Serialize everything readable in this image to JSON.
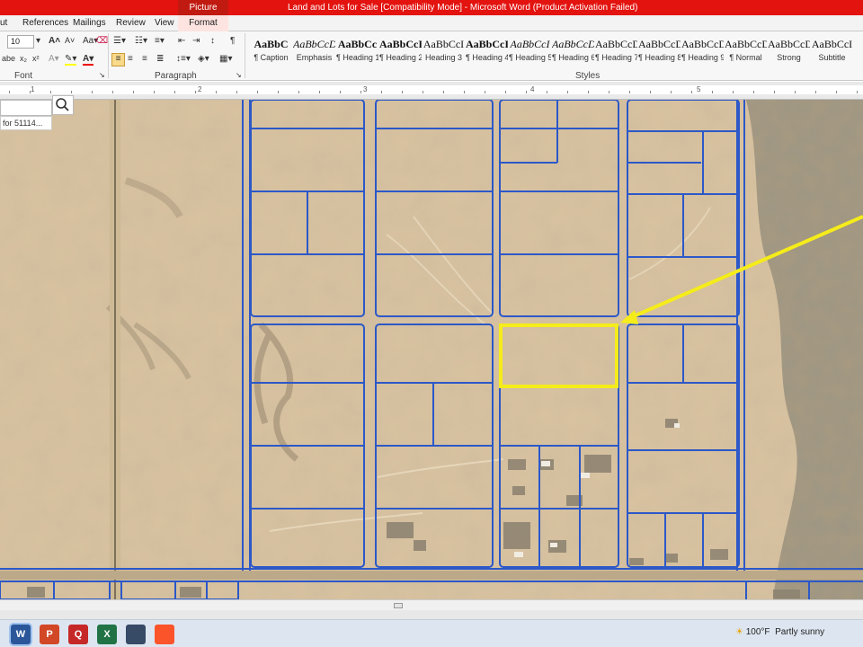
{
  "titlebar": {
    "title": "Land and Lots for Sale [Compatibility Mode] - Microsoft Word (Product Activation Failed)",
    "context_tab": "Picture Tools"
  },
  "tabs": [
    "ut",
    "References",
    "Mailings",
    "Review",
    "View"
  ],
  "context_format_tab": "Format",
  "ribbon": {
    "font_size": "10",
    "font_group": "Font",
    "paragraph_group": "Paragraph",
    "styles_group": "Styles",
    "styles": [
      {
        "preview": "AaBbC",
        "name": "¶ Caption"
      },
      {
        "preview": "AaBbCcDc",
        "name": "Emphasis"
      },
      {
        "preview": "AaBbCc",
        "name": "¶ Heading 1"
      },
      {
        "preview": "AaBbCcI",
        "name": "¶ Heading 2"
      },
      {
        "preview": "AaBbCcI",
        "name": "Heading 3"
      },
      {
        "preview": "AaBbCcI",
        "name": "¶ Heading 4"
      },
      {
        "preview": "AaBbCcI",
        "name": "¶ Heading 5"
      },
      {
        "preview": "AaBbCcDc",
        "name": "¶ Heading 6"
      },
      {
        "preview": "AaBbCcDc",
        "name": "¶ Heading 7"
      },
      {
        "preview": "AaBbCcDc",
        "name": "¶ Heading 8"
      },
      {
        "preview": "AaBbCcDc",
        "name": "¶ Heading 9"
      },
      {
        "preview": "AaBbCcDc",
        "name": "¶ Normal"
      },
      {
        "preview": "AaBbCcDd",
        "name": "Strong"
      },
      {
        "preview": "AaBbCcI",
        "name": "Subtitle"
      }
    ]
  },
  "ruler": {
    "numbers": [
      "1",
      "2",
      "3",
      "4",
      "5"
    ]
  },
  "map": {
    "search_result": "for 51114...",
    "parcel_line_color": "#2c58c8",
    "highlight_color": "#f5ec1a"
  },
  "taskbar": {
    "apps": [
      {
        "label": "W",
        "icon": "word-icon",
        "color": "#2b579a"
      },
      {
        "label": "P",
        "icon": "powerpoint-icon",
        "color": "#d24726"
      },
      {
        "label": "Q",
        "icon": "quicken-icon",
        "color": "#c62828"
      },
      {
        "label": "X",
        "icon": "excel-icon",
        "color": "#217346"
      },
      {
        "label": "",
        "icon": "car-icon",
        "color": "#374a66"
      },
      {
        "label": "",
        "icon": "brave-icon",
        "color": "#fb542b"
      }
    ],
    "weather_temp": "100°F",
    "weather_desc": "Partly sunny"
  }
}
